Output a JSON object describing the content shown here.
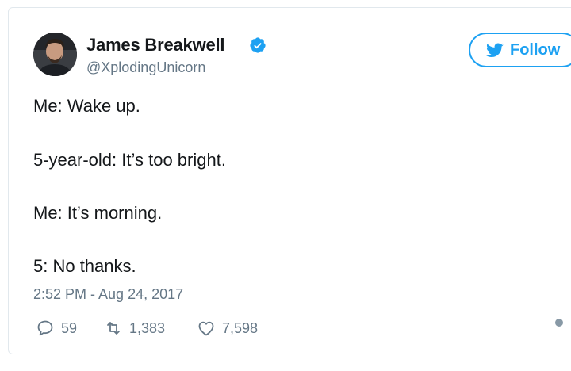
{
  "author": {
    "name": "James Breakwell",
    "handle": "@XplodingUnicorn",
    "verified": true
  },
  "follow_button": {
    "label": "Follow",
    "icon": "twitter-bird-icon"
  },
  "tweet": {
    "lines": [
      "Me: Wake up.",
      "5-year-old: It’s too bright.",
      "Me: It’s morning.",
      "5: No thanks."
    ],
    "timestamp": "2:52 PM - Aug 24, 2017"
  },
  "actions": {
    "replies": "59",
    "retweets": "1,383",
    "likes": "7,598"
  },
  "colors": {
    "accent": "#1da1f2",
    "muted": "#657786",
    "border": "#e1e8ed"
  }
}
